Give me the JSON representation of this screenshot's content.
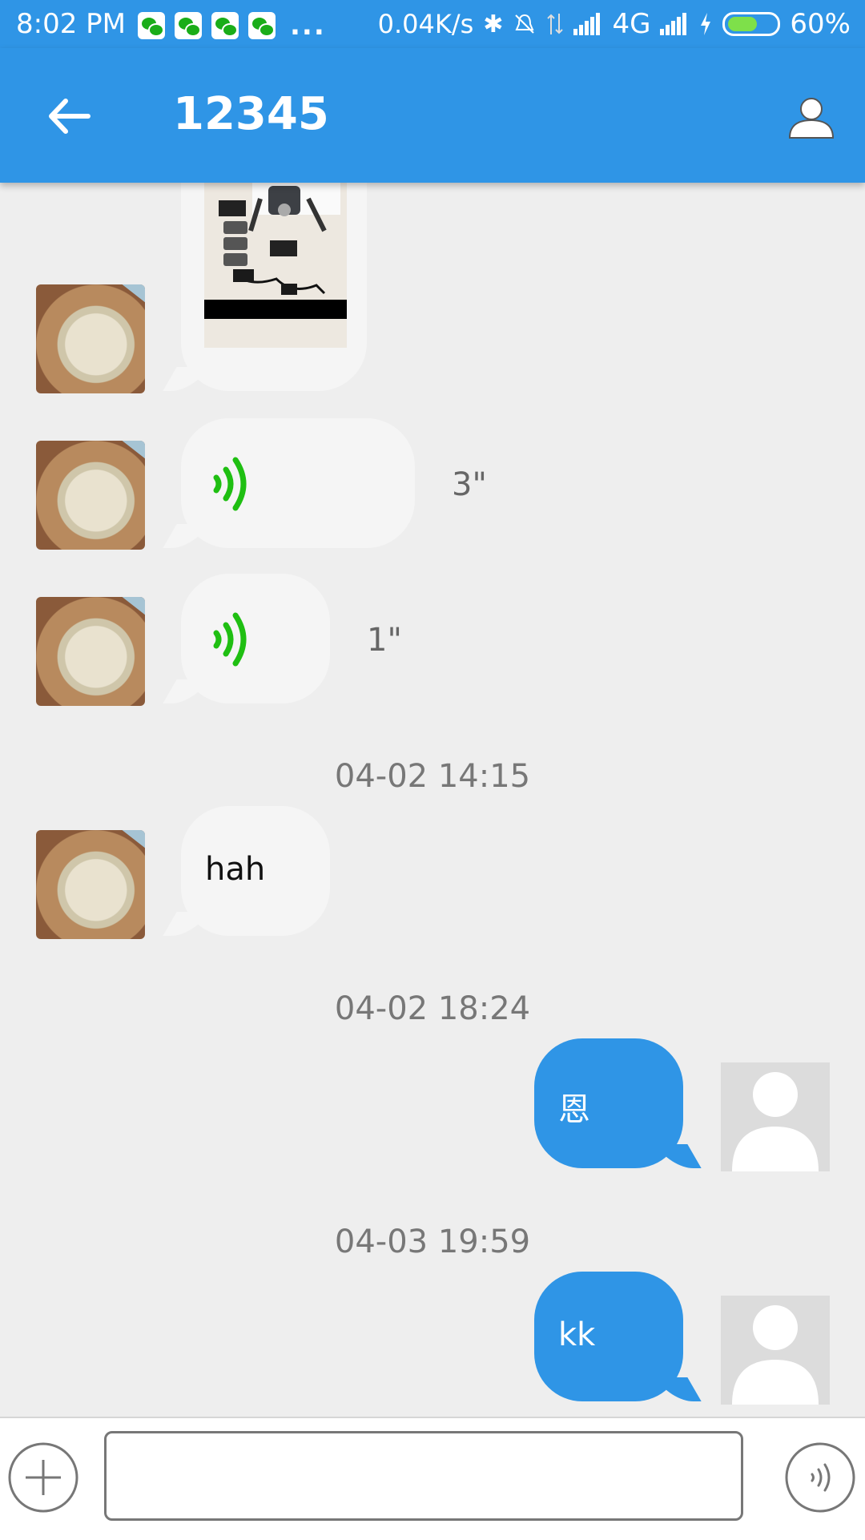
{
  "status_bar": {
    "time": "8:02 PM",
    "net_speed": "0.04K/s",
    "network": "4G",
    "battery": "60%",
    "notification_icons": [
      "wechat-icon",
      "wechat-icon",
      "wechat-icon",
      "wechat-icon"
    ],
    "more": "..."
  },
  "header": {
    "title": "12345",
    "back_icon": "arrow-left-icon",
    "contact_icon": "person-icon"
  },
  "messages": [
    {
      "side": "left",
      "type": "image"
    },
    {
      "side": "left",
      "type": "voice",
      "duration": "3\""
    },
    {
      "side": "left",
      "type": "voice",
      "duration": "1\""
    },
    {
      "type": "timestamp",
      "text": "04-02 14:15"
    },
    {
      "side": "left",
      "type": "text",
      "text": "hah"
    },
    {
      "type": "timestamp",
      "text": "04-02 18:24"
    },
    {
      "side": "right",
      "type": "text",
      "text": "恩"
    },
    {
      "type": "timestamp",
      "text": "04-03 19:59"
    },
    {
      "side": "right",
      "type": "text",
      "text": "kk"
    }
  ],
  "input_bar": {
    "plus_icon": "plus-icon",
    "input_placeholder": "",
    "voice_icon": "voice-icon"
  },
  "colors": {
    "primary": "#2f95e6",
    "background": "#eeeeee",
    "voice_green": "#1fbf12"
  }
}
